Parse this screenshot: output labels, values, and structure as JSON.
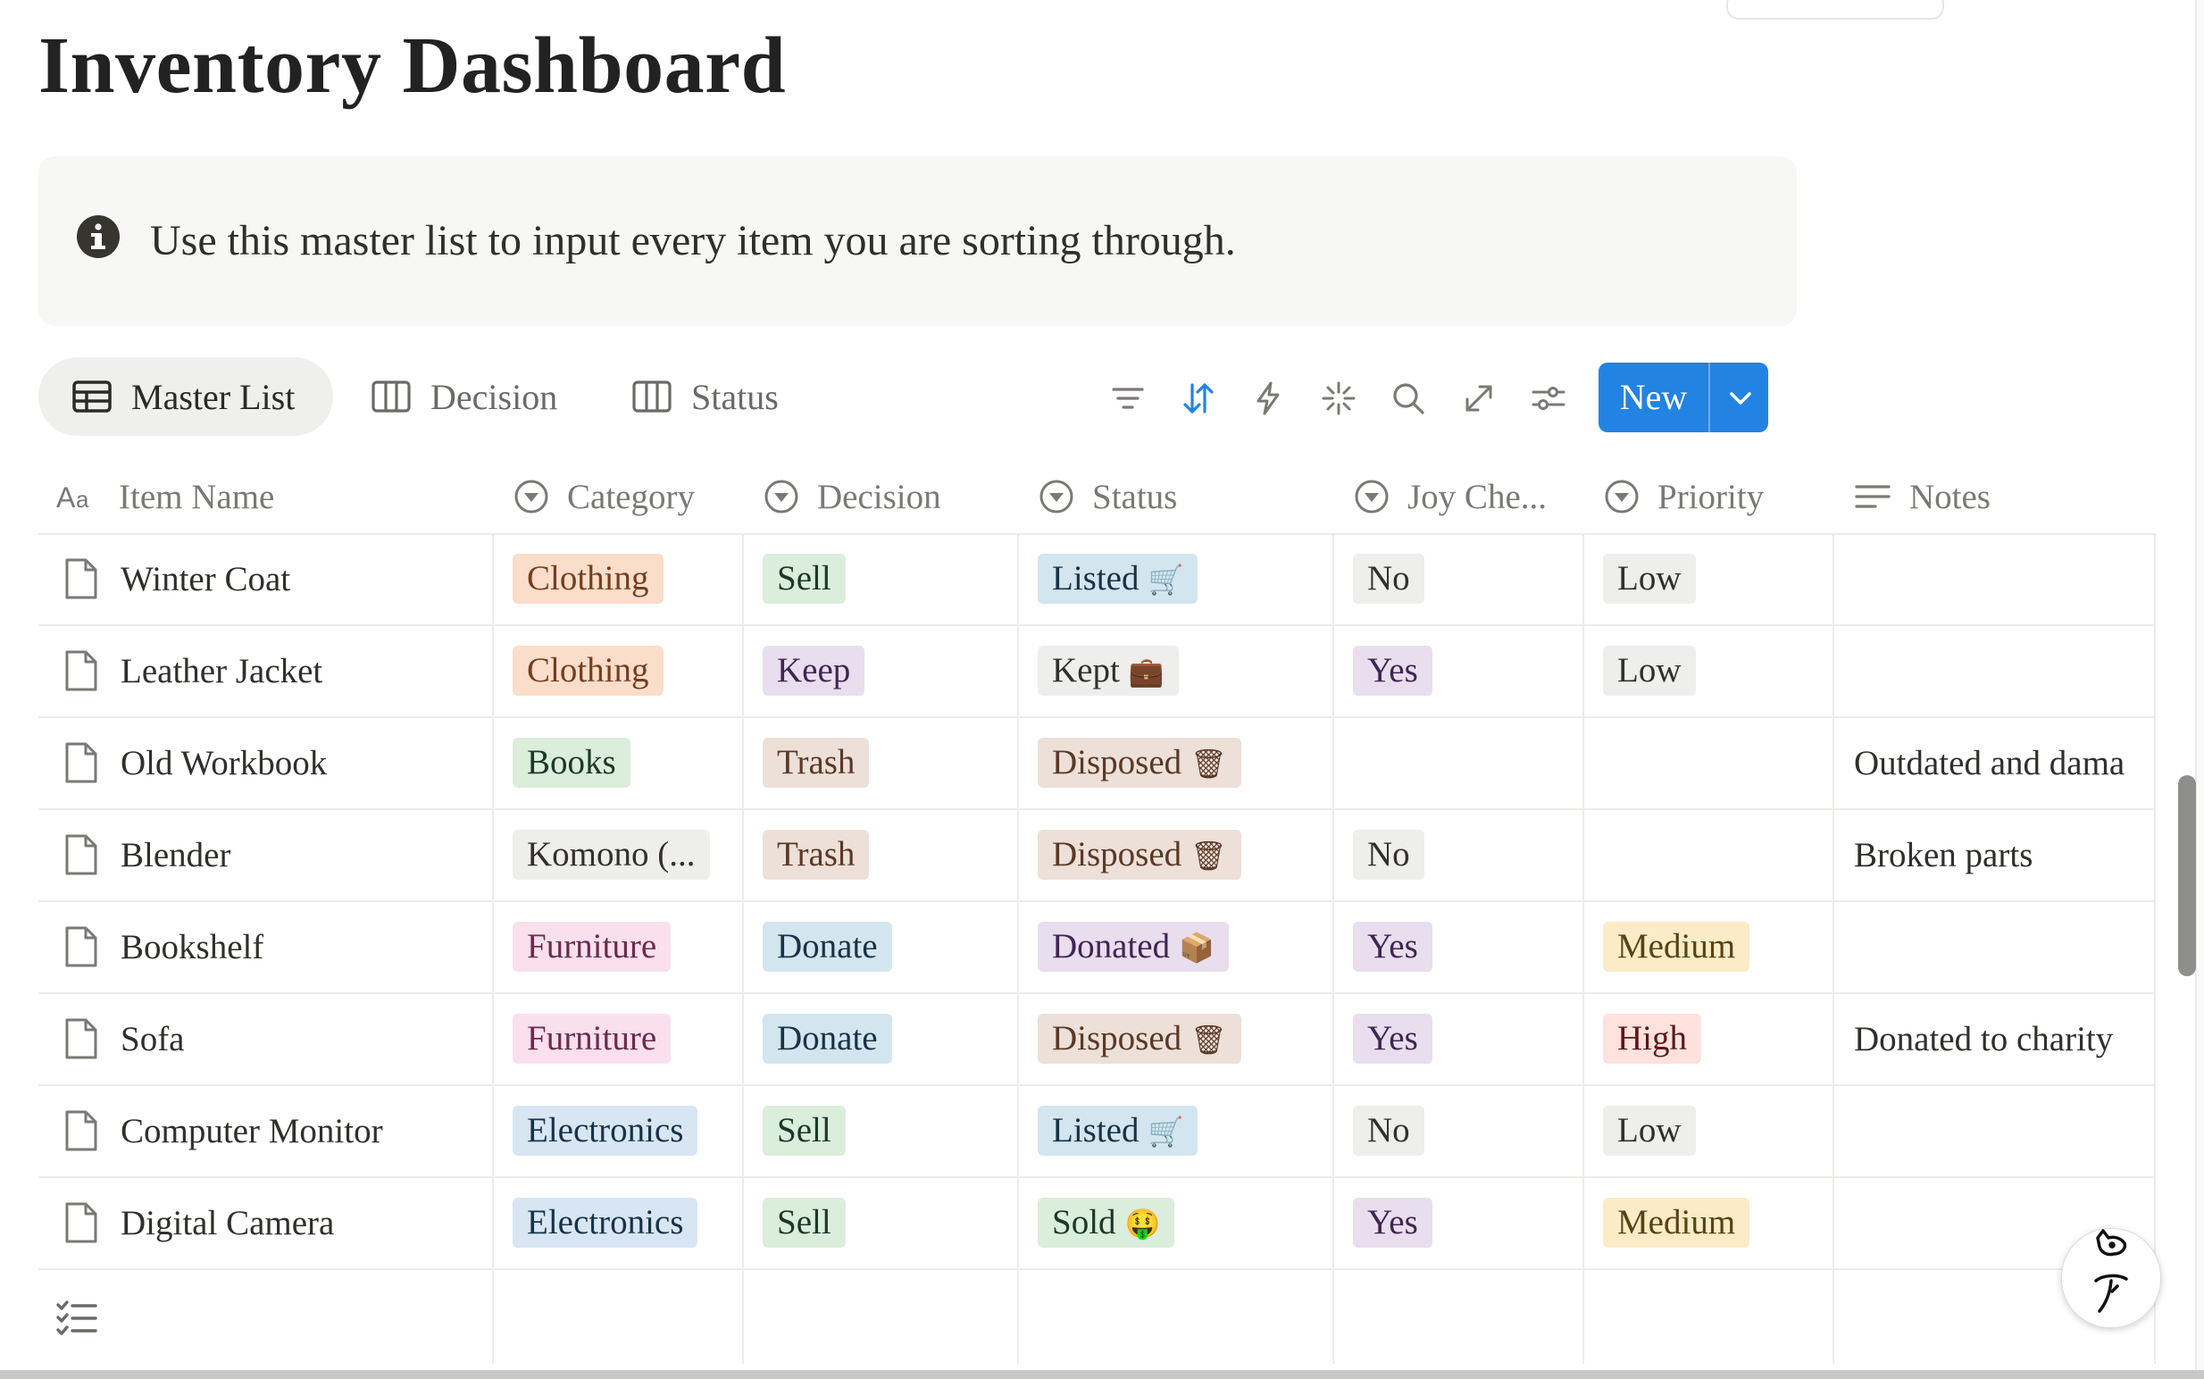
{
  "page": {
    "title": "Inventory Dashboard",
    "callout_text": "Use this master list to input every item you are sorting through."
  },
  "views": {
    "tabs": [
      {
        "label": "Master List",
        "active": true,
        "icon": "table-icon"
      },
      {
        "label": "Decision",
        "active": false,
        "icon": "board-icon"
      },
      {
        "label": "Status",
        "active": false,
        "icon": "board-icon"
      }
    ],
    "toolbar_icons": [
      "filter-icon",
      "sort-icon",
      "automation-icon",
      "ai-sparkle-icon",
      "search-icon",
      "expand-icon",
      "settings-icon"
    ],
    "new_label": "New",
    "accent": "#2383e2"
  },
  "table": {
    "columns": [
      {
        "label": "Item Name",
        "icon": "title-icon"
      },
      {
        "label": "Category",
        "icon": "select-icon"
      },
      {
        "label": "Decision",
        "icon": "select-icon"
      },
      {
        "label": "Status",
        "icon": "select-icon"
      },
      {
        "label": "Joy Che...",
        "icon": "select-icon"
      },
      {
        "label": "Priority",
        "icon": "select-icon"
      },
      {
        "label": "Notes",
        "icon": "text-icon"
      }
    ],
    "rows": [
      {
        "name": "Winter Coat",
        "category": "Clothing",
        "decision": "Sell",
        "status": "Listed",
        "status_emoji": "🛒",
        "joy": "No",
        "priority": "Low",
        "notes": ""
      },
      {
        "name": "Leather Jacket",
        "category": "Clothing",
        "decision": "Keep",
        "status": "Kept",
        "status_emoji": "💼",
        "joy": "Yes",
        "priority": "Low",
        "notes": ""
      },
      {
        "name": "Old Workbook",
        "category": "Books",
        "decision": "Trash",
        "status": "Disposed",
        "status_emoji": "🗑",
        "joy": "",
        "priority": "",
        "notes": "Outdated and dama"
      },
      {
        "name": "Blender",
        "category": "Komono (...",
        "decision": "Trash",
        "status": "Disposed",
        "status_emoji": "🗑",
        "joy": "No",
        "priority": "",
        "notes": "Broken parts"
      },
      {
        "name": "Bookshelf",
        "category": "Furniture",
        "decision": "Donate",
        "status": "Donated",
        "status_emoji": "📦",
        "joy": "Yes",
        "priority": "Medium",
        "notes": ""
      },
      {
        "name": "Sofa",
        "category": "Furniture",
        "decision": "Donate",
        "status": "Disposed",
        "status_emoji": "🗑",
        "joy": "Yes",
        "priority": "High",
        "notes": "Donated to charity"
      },
      {
        "name": "Computer Monitor",
        "category": "Electronics",
        "decision": "Sell",
        "status": "Listed",
        "status_emoji": "🛒",
        "joy": "No",
        "priority": "Low",
        "notes": ""
      },
      {
        "name": "Digital Camera",
        "category": "Electronics",
        "decision": "Sell",
        "status": "Sold",
        "status_emoji": "🤑",
        "joy": "Yes",
        "priority": "Medium",
        "notes": ""
      }
    ]
  }
}
